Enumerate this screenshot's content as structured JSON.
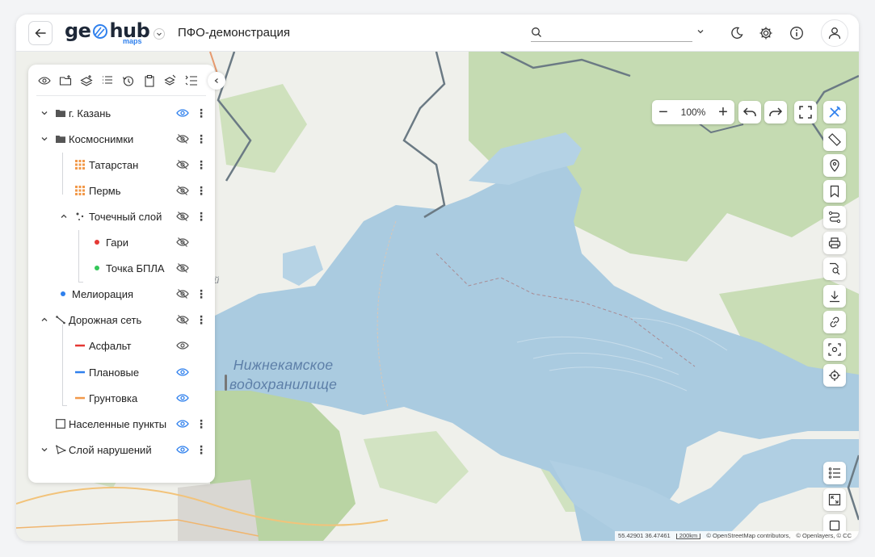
{
  "header": {
    "back_icon": "arrow-left-icon",
    "logo_text_left": "ge",
    "logo_text_right": "hub",
    "logo_sub": "maps",
    "project_title": "ПФО-демонстрация",
    "search": {
      "value": "",
      "placeholder": ""
    },
    "icons": [
      "search-icon",
      "chevron-down-icon",
      "moon-icon",
      "gear-icon",
      "info-icon",
      "user-icon"
    ]
  },
  "panel": {
    "tools": [
      "visibility-icon",
      "add-folder-icon",
      "add-layer-icon",
      "list-icon",
      "history-icon",
      "clipboard-icon",
      "layers-edit-icon",
      "list-settings-icon"
    ],
    "layers": [
      {
        "label": "г. Казань",
        "icon": "folder-icon",
        "expand": "collapsed",
        "visible": true,
        "menu": true
      },
      {
        "label": "Космоснимки",
        "icon": "folder-icon",
        "expand": "collapsed",
        "visible": false,
        "menu": true
      },
      {
        "label": "Татарстан",
        "icon": "raster-grid-icon",
        "expand": "none",
        "visible": false,
        "menu": true
      },
      {
        "label": "Пермь",
        "icon": "raster-grid-icon",
        "expand": "none",
        "visible": false,
        "menu": true
      },
      {
        "label": "Точечный слой",
        "icon": "point-layer-icon",
        "expand": "expanded",
        "visible": false,
        "menu": true
      },
      {
        "label": "Гари",
        "icon": "red-dot-icon",
        "expand": "none",
        "visible": false,
        "menu": false
      },
      {
        "label": "Точка БПЛА",
        "icon": "green-dot-icon",
        "expand": "none",
        "visible": false,
        "menu": false
      },
      {
        "label": "Мелиорация",
        "icon": "blue-dot-icon",
        "expand": "none",
        "visible": false,
        "menu": true
      },
      {
        "label": "Дорожная сеть",
        "icon": "line-layer-icon",
        "expand": "expanded",
        "visible": false,
        "menu": true
      },
      {
        "label": "Асфальт",
        "icon": "red-line-icon",
        "expand": "none",
        "visible": true,
        "active": false,
        "menu": false
      },
      {
        "label": "Плановые",
        "icon": "blue-line-icon",
        "expand": "none",
        "visible": true,
        "active": true,
        "menu": false
      },
      {
        "label": "Грунтовка",
        "icon": "orange-line-icon",
        "expand": "none",
        "visible": true,
        "active": true,
        "menu": false
      },
      {
        "label": "Населенные пункты",
        "icon": "polygon-square-icon",
        "expand": "none",
        "visible": true,
        "menu": true
      },
      {
        "label": "Слой нарушений",
        "icon": "polygon-layer-icon",
        "expand": "collapsed",
        "visible": true,
        "menu": true
      }
    ]
  },
  "map": {
    "lake_label_line1": "Нижнекамское",
    "lake_label_line2": "водохранилище",
    "partial_label": "ий",
    "zoom_value": "100%",
    "zoom_out": "−",
    "zoom_in": "+",
    "right_tools": [
      "tools-icon",
      "ruler-icon",
      "location-pin-icon",
      "bookmark-icon",
      "route-icon",
      "print-icon",
      "search-map-icon",
      "download-icon",
      "link-icon",
      "screenshot-icon",
      "locate-icon"
    ],
    "bottom_tools": [
      "legend-icon",
      "extent-icon",
      "square-icon"
    ],
    "attribution": {
      "coords": "55.42901 36.47461",
      "scale": "200km",
      "osm": "© OpenStreetMap contributors,",
      "ol": "© Openlayers, © CC"
    }
  },
  "colors": {
    "accent": "#2f80ed",
    "water": "#aacbe0",
    "forest": "#c5dbb2",
    "land": "#eff0eb",
    "border": "#6b7a84"
  }
}
